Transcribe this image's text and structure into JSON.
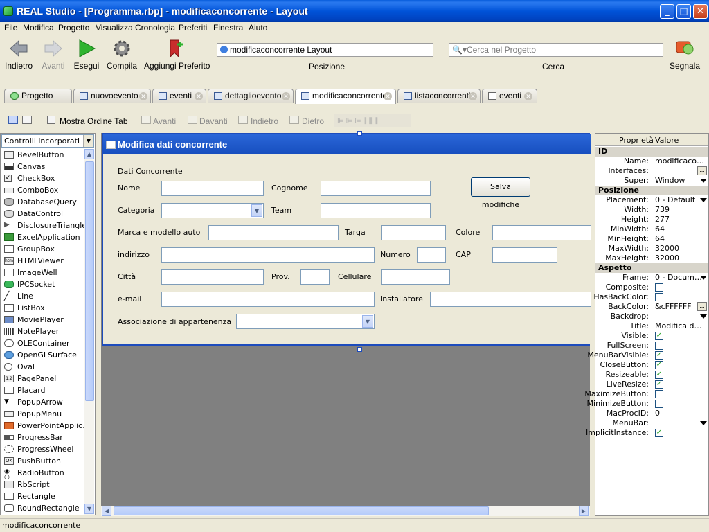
{
  "window": {
    "title": "REAL Studio - [Programma.rbp] - modificaconcorrente - Layout",
    "min_label": "_",
    "max_label": "□",
    "close_label": "✕"
  },
  "menu": [
    "File",
    "Modifica",
    "Progetto",
    "Visualizza",
    "Cronologia",
    "Preferiti",
    "Finestra",
    "Aiuto"
  ],
  "toolbar": {
    "back": "Indietro",
    "forward": "Avanti",
    "run": "Esegui",
    "compile": "Compila",
    "bookmark": "Aggiungi Preferito",
    "location_value": "modificaconcorrente Layout",
    "location_label": "Posizione",
    "search_placeholder": "Cerca nel Progetto",
    "search_label": "Cerca",
    "report": "Segnala"
  },
  "tabs": [
    {
      "label": "Progetto",
      "closable": false
    },
    {
      "label": "nuovoevento",
      "closable": true
    },
    {
      "label": "eventi",
      "closable": true
    },
    {
      "label": "dettaglioevento",
      "closable": true
    },
    {
      "label": "modificaconcorrente",
      "closable": true,
      "active": true
    },
    {
      "label": "listaconcorrenti",
      "closable": true
    },
    {
      "label": "eventi",
      "closable": true
    }
  ],
  "layout_toolbar": {
    "tab_order": "Mostra Ordine Tab",
    "forward": "Avanti",
    "front": "Davanti",
    "backward": "Indietro",
    "behind": "Dietro"
  },
  "controls": {
    "selector": "Controlli incorporati",
    "items": [
      "BevelButton",
      "Canvas",
      "CheckBox",
      "ComboBox",
      "DatabaseQuery",
      "DataControl",
      "DisclosureTriangle",
      "ExcelApplication",
      "GroupBox",
      "HTMLViewer",
      "ImageWell",
      "IPCSocket",
      "Line",
      "ListBox",
      "MoviePlayer",
      "NotePlayer",
      "OLEContainer",
      "OpenGLSurface",
      "Oval",
      "PagePanel",
      "Placard",
      "PopupArrow",
      "PopupMenu",
      "PowerPointApplic...",
      "ProgressBar",
      "ProgressWheel",
      "PushButton",
      "RadioButton",
      "RbScript",
      "Rectangle",
      "RoundRectangle"
    ]
  },
  "design": {
    "title": "Modifica dati concorrente",
    "group": "Dati Concorrente",
    "nome": "Nome",
    "cognome": "Cognome",
    "save": "Salva modifiche",
    "categoria": "Categoria",
    "team": "Team",
    "marca": "Marca e modello auto",
    "targa": "Targa",
    "colore": "Colore",
    "indirizzo": "indirizzo",
    "numero": "Numero",
    "cap": "CAP",
    "citta": "Città",
    "prov": "Prov.",
    "cellulare": "Cellulare",
    "email": "e-mail",
    "installatore": "Installatore",
    "associazione": "Associazione di appartenenza"
  },
  "properties": {
    "col_name": "Proprietà",
    "col_value": "Valore",
    "rows": [
      {
        "section": "ID"
      },
      {
        "name": "Name:",
        "value": "modificaconc..."
      },
      {
        "name": "Interfaces:",
        "value": "",
        "dots": true
      },
      {
        "name": "Super:",
        "value": "Window",
        "drop": true
      },
      {
        "section": "Posizione"
      },
      {
        "name": "Placement:",
        "value": "0 - Default",
        "drop": true
      },
      {
        "name": "Width:",
        "value": "739"
      },
      {
        "name": "Height:",
        "value": "277"
      },
      {
        "name": "MinWidth:",
        "value": "64"
      },
      {
        "name": "MinHeight:",
        "value": "64"
      },
      {
        "name": "MaxWidth:",
        "value": "32000"
      },
      {
        "name": "MaxHeight:",
        "value": "32000"
      },
      {
        "section": "Aspetto"
      },
      {
        "name": "Frame:",
        "value": "0 - Document",
        "drop": true
      },
      {
        "name": "Composite:",
        "check": false
      },
      {
        "name": "HasBackColor:",
        "check": false
      },
      {
        "name": "BackColor:",
        "value": "&cFFFFFF",
        "dots": true
      },
      {
        "name": "Backdrop:",
        "value": "",
        "drop": true
      },
      {
        "name": "Title:",
        "value": "Modifica dati ..."
      },
      {
        "name": "Visible:",
        "check": true
      },
      {
        "name": "FullScreen:",
        "check": false
      },
      {
        "name": "MenuBarVisible:",
        "check": true
      },
      {
        "name": "CloseButton:",
        "check": true
      },
      {
        "name": "Resizeable:",
        "check": true
      },
      {
        "name": "LiveResize:",
        "check": true
      },
      {
        "name": "MaximizeButton:",
        "check": false
      },
      {
        "name": "MinimizeButton:",
        "check": false
      },
      {
        "name": "MacProcID:",
        "value": "0"
      },
      {
        "name": "MenuBar:",
        "value": "",
        "drop": true
      },
      {
        "name": "ImplicitInstance:",
        "check": true
      }
    ]
  },
  "status": "modificaconcorrente",
  "colors": {
    "titlebar": "#0053d8",
    "design_title": "#1d4cbd",
    "canvas": "#808080"
  }
}
